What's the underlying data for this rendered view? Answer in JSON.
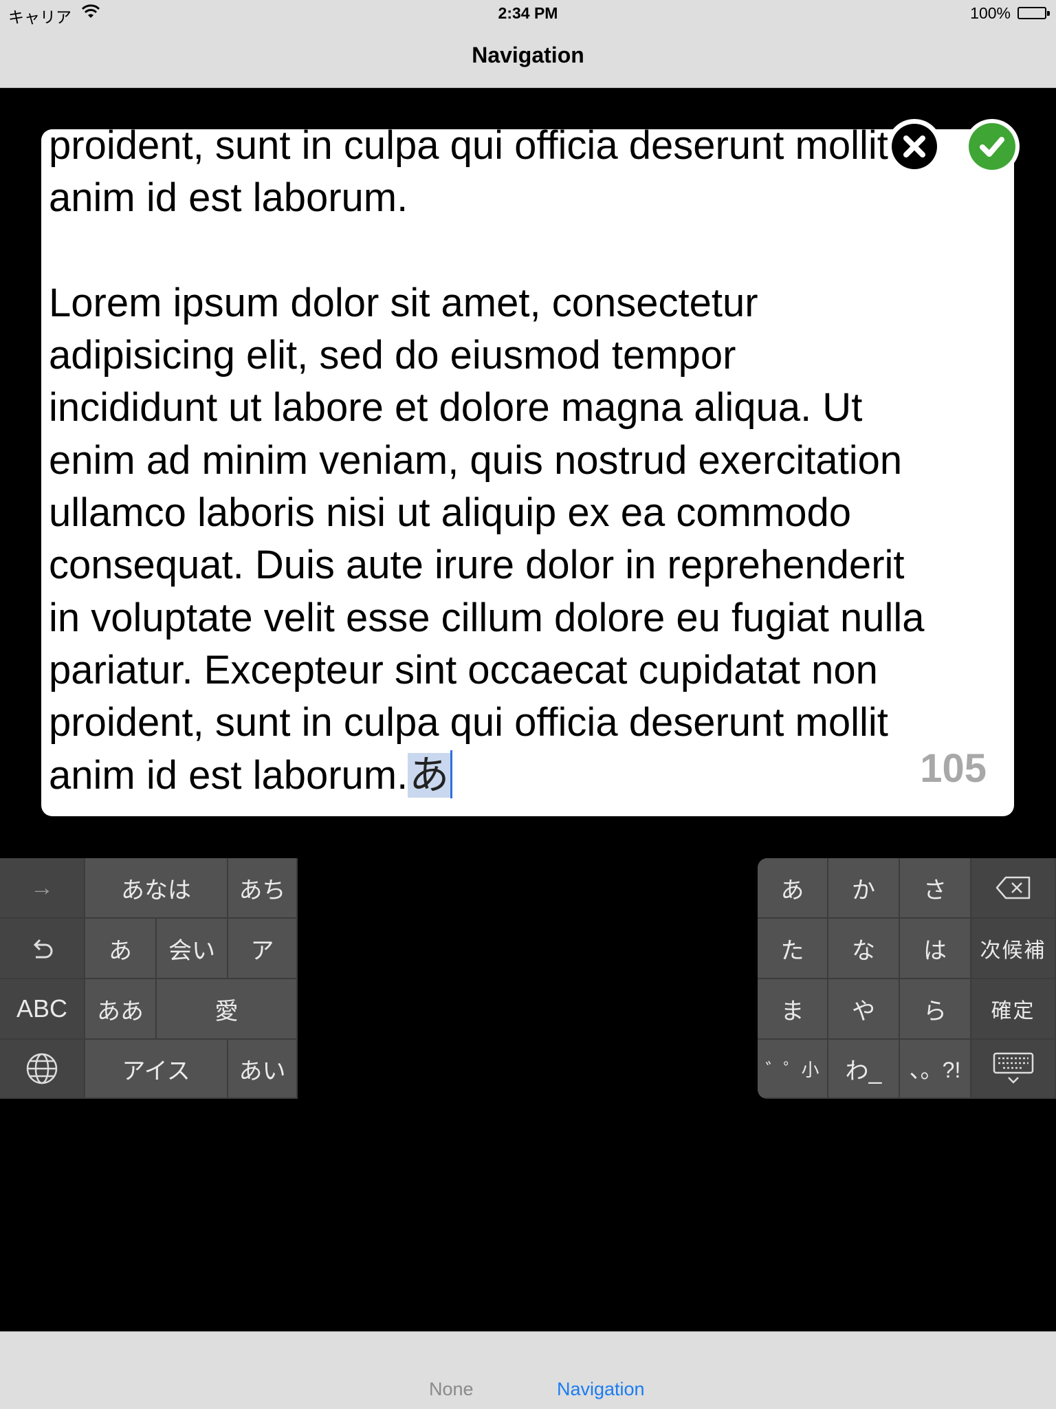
{
  "status_bar": {
    "carrier": "キャリア",
    "time": "2:34 PM",
    "battery_percent": "100%"
  },
  "nav": {
    "title": "Navigation"
  },
  "editor": {
    "lines": [
      "proident, sunt in culpa qui officia deserunt mollit",
      "anim id est laborum.",
      "",
      "Lorem ipsum dolor sit amet, consectetur",
      "adipisicing elit, sed do eiusmod tempor",
      "incididunt ut labore et dolore magna aliqua. Ut",
      "enim ad minim veniam, quis nostrud exercitation",
      "ullamco laboris nisi ut aliquip ex ea commodo",
      "consequat. Duis aute irure dolor in reprehenderit",
      "in voluptate velit esse cillum dolore eu fugiat nulla",
      "pariatur. Excepteur sint occaecat cupidatat non",
      "proident, sunt in culpa qui officia deserunt mollit",
      "anim id est laborum."
    ],
    "composing_text": "あ",
    "remaining_count": "105"
  },
  "buttons": {
    "cancel_icon": "close-icon",
    "confirm_icon": "checkmark-icon"
  },
  "left_keyboard": {
    "rows": [
      [
        "→",
        "あなは",
        "あち"
      ],
      [
        "↺",
        "あ",
        "会い",
        "ア"
      ],
      [
        "ABC",
        "ああ",
        "愛"
      ],
      [
        "🌐",
        "アイス",
        "あい"
      ]
    ]
  },
  "right_keyboard": {
    "rows": [
      [
        "あ",
        "か",
        "さ",
        "⌫"
      ],
      [
        "た",
        "な",
        "は",
        "次候補"
      ],
      [
        "ま",
        "や",
        "ら",
        "確定"
      ],
      [
        "゛゜小",
        "わ_",
        "、。?!",
        "⌨"
      ]
    ]
  },
  "tab_bar": {
    "tabs": [
      "None",
      "Navigation"
    ],
    "selected": "Navigation",
    "selected_color": "#1a7cf2"
  }
}
